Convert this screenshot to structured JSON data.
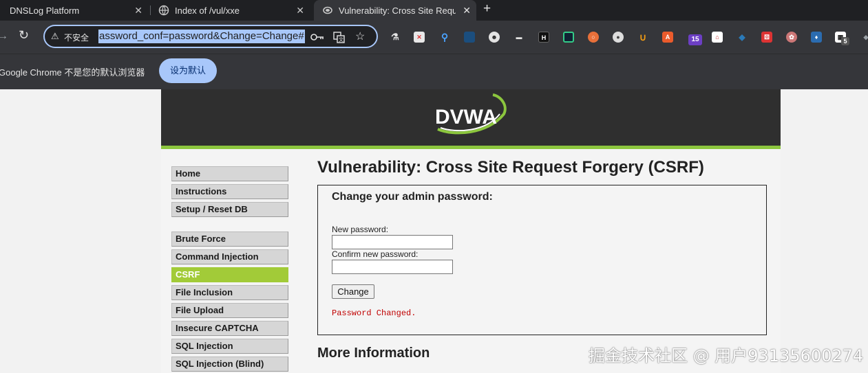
{
  "tabs": [
    {
      "title": "DNSLog Platform",
      "close": "✕"
    },
    {
      "title": "Index of /vul/xxe",
      "close": "✕"
    },
    {
      "title": "Vulnerability: Cross Site Requ",
      "close": "✕"
    }
  ],
  "toolbar": {
    "security_label": "不安全",
    "url": "assword_conf=password&Change=Change#",
    "extension_badges": {
      "grid": "15",
      "qr": "5"
    }
  },
  "infobar": {
    "message": "Google Chrome 不是您的默认浏览器",
    "button": "设为默认"
  },
  "dvwa": {
    "logo_text": "DVWA",
    "menu": [
      "Home",
      "Instructions",
      "Setup / Reset DB",
      "Brute Force",
      "Command Injection",
      "CSRF",
      "File Inclusion",
      "File Upload",
      "Insecure CAPTCHA",
      "SQL Injection",
      "SQL Injection (Blind)"
    ],
    "title": "Vulnerability: Cross Site Request Forgery (CSRF)",
    "form": {
      "heading": "Change your admin password:",
      "new_label": "New password:",
      "confirm_label": "Confirm new password:",
      "button": "Change",
      "result": "Password Changed."
    },
    "more_info": "More Information"
  },
  "watermark": "掘金技术社区 @ 用户93135600274",
  "colors": {
    "dvwa_green": "#8cc63e",
    "active_menu": "#a2cb38",
    "result_red": "#c00000",
    "chrome_accent": "#a8c7fa"
  }
}
